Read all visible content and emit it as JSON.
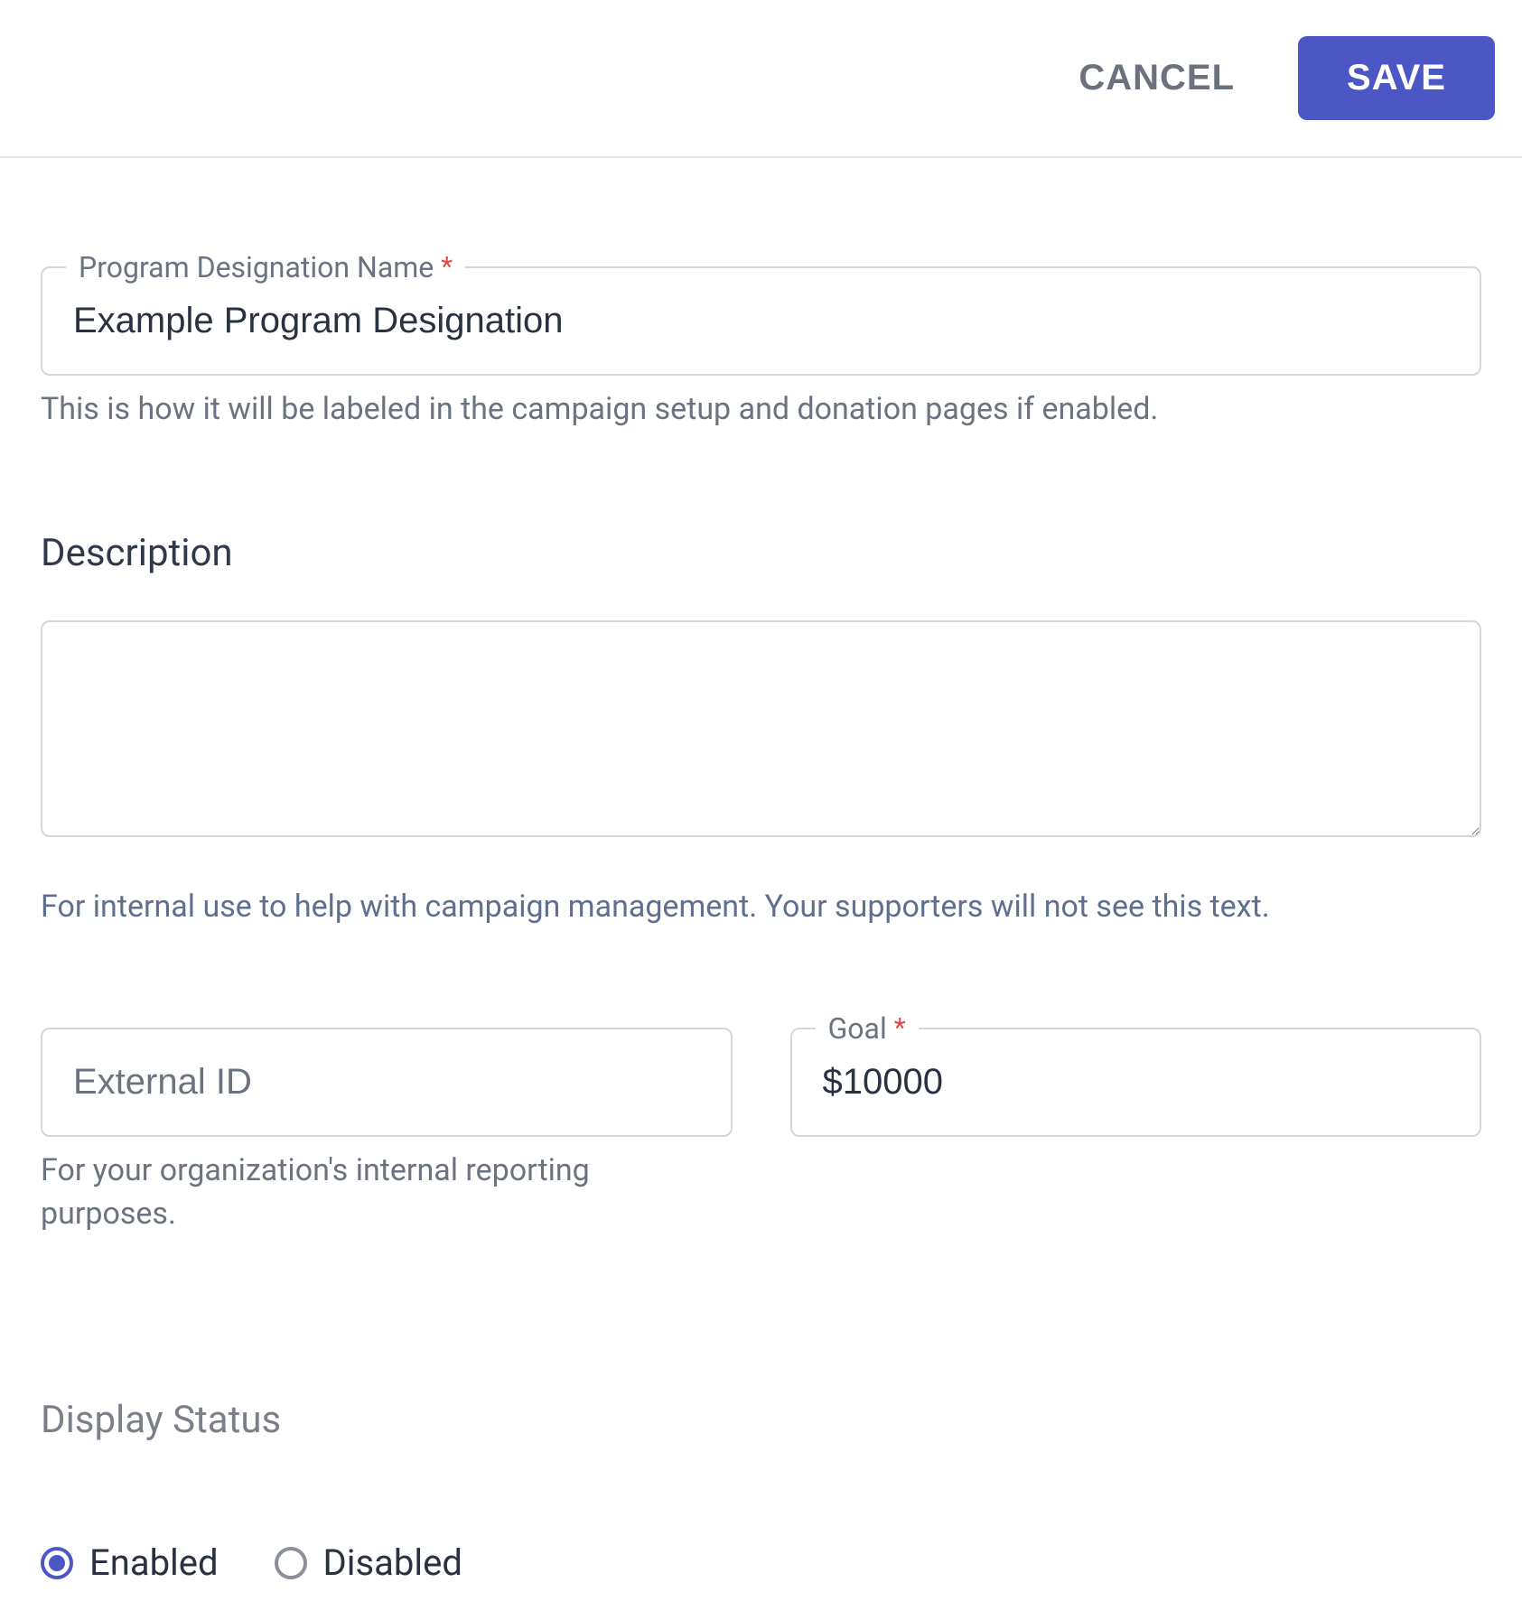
{
  "actions": {
    "cancel": "CANCEL",
    "save": "SAVE"
  },
  "form": {
    "name": {
      "label": "Program Designation Name",
      "value": "Example Program Designation",
      "helper": "This is how it will be labeled in the campaign setup and donation pages if enabled."
    },
    "description": {
      "heading": "Description",
      "value": "",
      "helper": "For internal use to help with campaign management. Your supporters will not see this text."
    },
    "external_id": {
      "placeholder": "External ID",
      "value": "",
      "helper": "For your organization's internal reporting purposes."
    },
    "goal": {
      "label": "Goal",
      "value": "$10000"
    },
    "display_status": {
      "heading": "Display Status",
      "options": {
        "enabled": "Enabled",
        "disabled": "Disabled"
      },
      "selected": "enabled"
    }
  }
}
